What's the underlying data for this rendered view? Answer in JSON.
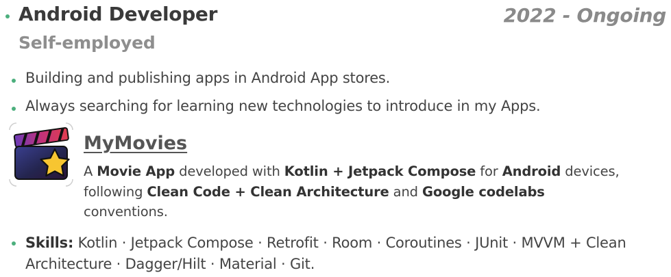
{
  "job": {
    "title": "Android Developer",
    "period": "2022 - Ongoing",
    "company": "Self-employed"
  },
  "highlights": [
    "Building and publishing apps in Android App stores.",
    "Always searching for learning new technologies to introduce in my Apps."
  ],
  "project": {
    "name": "MyMovies",
    "icon": "movie-star-app-icon",
    "desc": {
      "t1": "A ",
      "b1": "Movie App",
      "t2": " developed with ",
      "b2": "Kotlin + Jetpack Compose",
      "t3": " for ",
      "b3": "Android",
      "t4": " devices, following ",
      "b4": "Clean Code + Clean Architecture",
      "t5": " and ",
      "b5": "Google codelabs",
      "t6": " conventions."
    }
  },
  "skills": {
    "label": "Skills:",
    "list": " Kotlin · Jetpack Compose · Retrofit · Room · Coroutines · JUnit · MVVM + Clean Architecture · Dagger/Hilt · Material · Git."
  },
  "colors": {
    "bullet": "#4caf7d",
    "title": "#3a3a3a",
    "muted": "#8a8a8a",
    "star": "#f7c531"
  }
}
